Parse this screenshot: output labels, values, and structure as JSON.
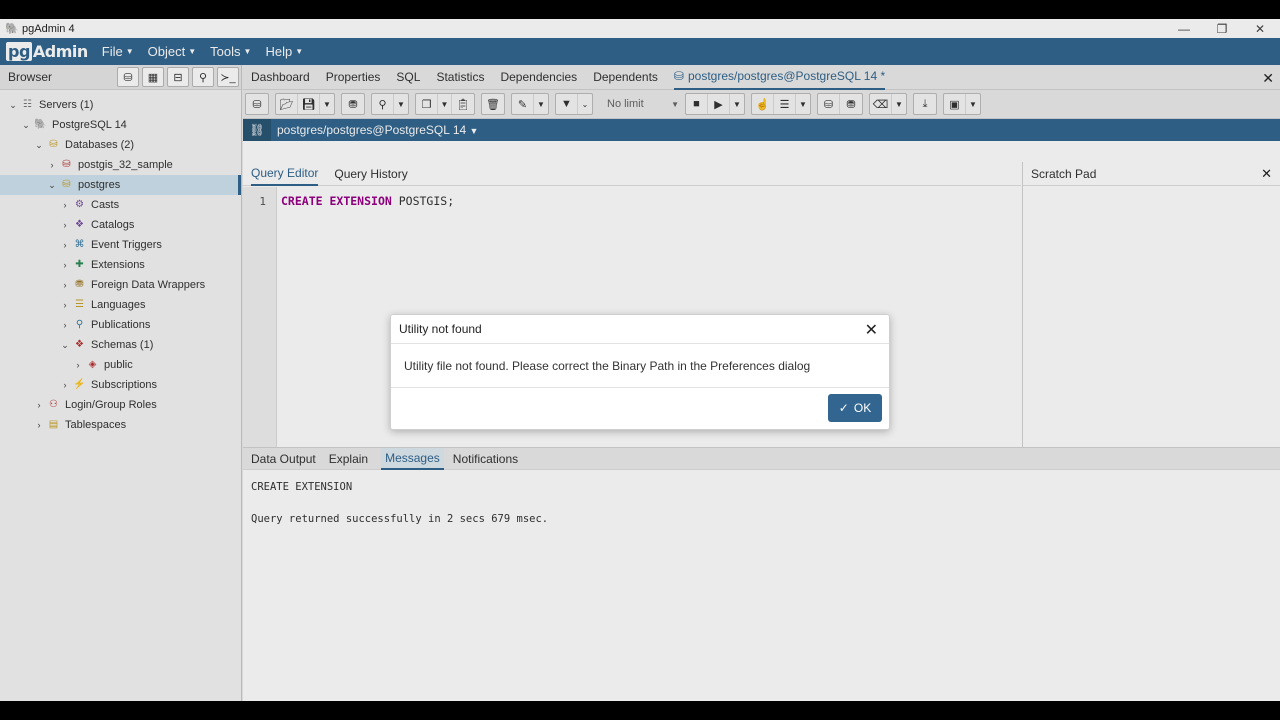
{
  "window": {
    "title": "pgAdmin 4",
    "minimize": "—",
    "restore": "❐",
    "close": "✕"
  },
  "menubar": {
    "logo_pg": "pg",
    "logo_rest": "Admin",
    "items": [
      "File",
      "Object",
      "Tools",
      "Help"
    ]
  },
  "browser": {
    "title": "Browser",
    "tree": [
      {
        "label": "Servers (1)",
        "expanded": true,
        "level": 0
      },
      {
        "label": "PostgreSQL 14",
        "expanded": true,
        "level": 1
      },
      {
        "label": "Databases (2)",
        "expanded": true,
        "level": 2
      },
      {
        "label": "postgis_32_sample",
        "expanded": false,
        "level": 3
      },
      {
        "label": "postgres",
        "expanded": true,
        "level": 3,
        "selected": true
      },
      {
        "label": "Casts",
        "expanded": false,
        "level": 4
      },
      {
        "label": "Catalogs",
        "expanded": false,
        "level": 4
      },
      {
        "label": "Event Triggers",
        "expanded": false,
        "level": 4
      },
      {
        "label": "Extensions",
        "expanded": false,
        "level": 4
      },
      {
        "label": "Foreign Data Wrappers",
        "expanded": false,
        "level": 4
      },
      {
        "label": "Languages",
        "expanded": false,
        "level": 4
      },
      {
        "label": "Publications",
        "expanded": false,
        "level": 4
      },
      {
        "label": "Schemas (1)",
        "expanded": true,
        "level": 4
      },
      {
        "label": "public",
        "expanded": false,
        "level": 5
      },
      {
        "label": "Subscriptions",
        "expanded": false,
        "level": 4
      },
      {
        "label": "Login/Group Roles",
        "expanded": false,
        "level": 2
      },
      {
        "label": "Tablespaces",
        "expanded": false,
        "level": 2
      }
    ]
  },
  "main": {
    "tabs": [
      "Dashboard",
      "Properties",
      "SQL",
      "Statistics",
      "Dependencies",
      "Dependents"
    ],
    "active_tab": "postgres/postgres@PostgreSQL 14 *",
    "toolbar": {
      "limit": "No limit"
    },
    "connection": "postgres/postgres@PostgreSQL 14",
    "editor_tabs": [
      "Query Editor",
      "Query History"
    ],
    "scratch_pad": "Scratch Pad",
    "code": {
      "line_number": "1",
      "kw1": "CREATE",
      "kw2": "EXTENSION",
      "ident": "POSTGIS;"
    },
    "output_tabs": [
      "Data Output",
      "Explain",
      "Messages",
      "Notifications"
    ],
    "messages": [
      "CREATE EXTENSION",
      "Query returned successfully in 2 secs 679 msec."
    ]
  },
  "dialog": {
    "title": "Utility not found",
    "message": "Utility file not found. Please correct the Binary Path in the Preferences dialog",
    "ok_label": "OK"
  },
  "colors": {
    "brand": "#326690",
    "selection": "#cfe3ef"
  }
}
